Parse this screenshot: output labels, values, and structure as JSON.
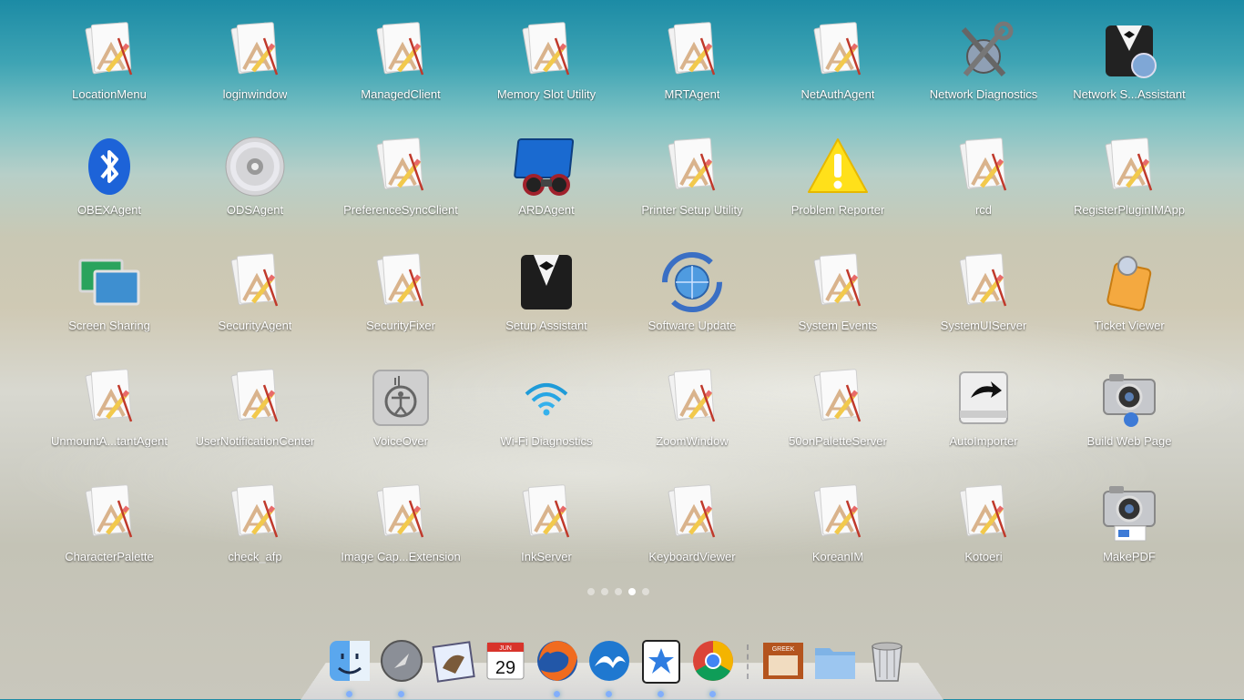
{
  "apps": [
    {
      "label": "LocationMenu",
      "icon": "generic-app-icon"
    },
    {
      "label": "loginwindow",
      "icon": "generic-app-icon"
    },
    {
      "label": "ManagedClient",
      "icon": "generic-app-icon"
    },
    {
      "label": "Memory Slot Utility",
      "icon": "generic-app-icon"
    },
    {
      "label": "MRTAgent",
      "icon": "generic-app-icon"
    },
    {
      "label": "NetAuthAgent",
      "icon": "generic-app-icon"
    },
    {
      "label": "Network Diagnostics",
      "icon": "network-diagnostics-icon"
    },
    {
      "label": "Network S...Assistant",
      "icon": "butler-globe-icon"
    },
    {
      "label": "OBEXAgent",
      "icon": "bluetooth-icon"
    },
    {
      "label": "ODSAgent",
      "icon": "disc-icon"
    },
    {
      "label": "PreferenceSyncClient",
      "icon": "generic-app-icon"
    },
    {
      "label": "ARDAgent",
      "icon": "binoculars-screen-icon"
    },
    {
      "label": "Printer Setup Utility",
      "icon": "generic-app-icon"
    },
    {
      "label": "Problem Reporter",
      "icon": "warning-icon"
    },
    {
      "label": "rcd",
      "icon": "generic-app-icon"
    },
    {
      "label": "RegisterPluginIMApp",
      "icon": "generic-app-icon"
    },
    {
      "label": "Screen Sharing",
      "icon": "screen-sharing-icon"
    },
    {
      "label": "SecurityAgent",
      "icon": "generic-app-icon"
    },
    {
      "label": "SecurityFixer",
      "icon": "generic-app-icon"
    },
    {
      "label": "Setup Assistant",
      "icon": "butler-icon"
    },
    {
      "label": "Software Update",
      "icon": "software-update-icon"
    },
    {
      "label": "System Events",
      "icon": "generic-app-icon"
    },
    {
      "label": "SystemUIServer",
      "icon": "generic-app-icon"
    },
    {
      "label": "Ticket Viewer",
      "icon": "ticket-viewer-icon"
    },
    {
      "label": "UnmountA...tantAgent",
      "icon": "generic-app-icon"
    },
    {
      "label": "UserNotificationCenter",
      "icon": "generic-app-icon"
    },
    {
      "label": "VoiceOver",
      "icon": "accessibility-icon"
    },
    {
      "label": "Wi-Fi Diagnostics",
      "icon": "wifi-icon"
    },
    {
      "label": "ZoomWindow",
      "icon": "generic-app-icon"
    },
    {
      "label": "50onPaletteServer",
      "icon": "generic-app-icon"
    },
    {
      "label": "AutoImporter",
      "icon": "auto-importer-icon"
    },
    {
      "label": "Build Web Page",
      "icon": "camera-icon"
    },
    {
      "label": "CharacterPalette",
      "icon": "generic-app-icon"
    },
    {
      "label": "check_afp",
      "icon": "generic-app-icon"
    },
    {
      "label": "Image Cap...Extension",
      "icon": "generic-app-icon"
    },
    {
      "label": "InkServer",
      "icon": "generic-app-icon"
    },
    {
      "label": "KeyboardViewer",
      "icon": "generic-app-icon"
    },
    {
      "label": "KoreanIM",
      "icon": "generic-app-icon"
    },
    {
      "label": "Kotoeri",
      "icon": "generic-app-icon"
    },
    {
      "label": "MakePDF",
      "icon": "camera-pdf-icon"
    }
  ],
  "pagination": {
    "total_pages": 5,
    "current_page": 4
  },
  "dock": [
    {
      "icon": "finder-icon",
      "running": true
    },
    {
      "icon": "launchpad-icon",
      "running": true
    },
    {
      "icon": "mail-icon",
      "running": false
    },
    {
      "icon": "calendar-icon",
      "running": false,
      "month": "JUN",
      "day": "29"
    },
    {
      "icon": "firefox-icon",
      "running": true
    },
    {
      "icon": "openoffice-icon",
      "running": true
    },
    {
      "icon": "safari-starred-icon",
      "running": true
    },
    {
      "icon": "chrome-icon",
      "running": true
    },
    {
      "icon": "greek-book-icon",
      "running": false,
      "label": "GREEK"
    },
    {
      "icon": "folder-icon",
      "running": false
    },
    {
      "icon": "trash-icon",
      "running": false
    }
  ],
  "colors": {
    "label_text": "#ffffff",
    "dot_active": "#ffffff",
    "dot_inactive": "rgba(255,255,255,0.45)"
  }
}
